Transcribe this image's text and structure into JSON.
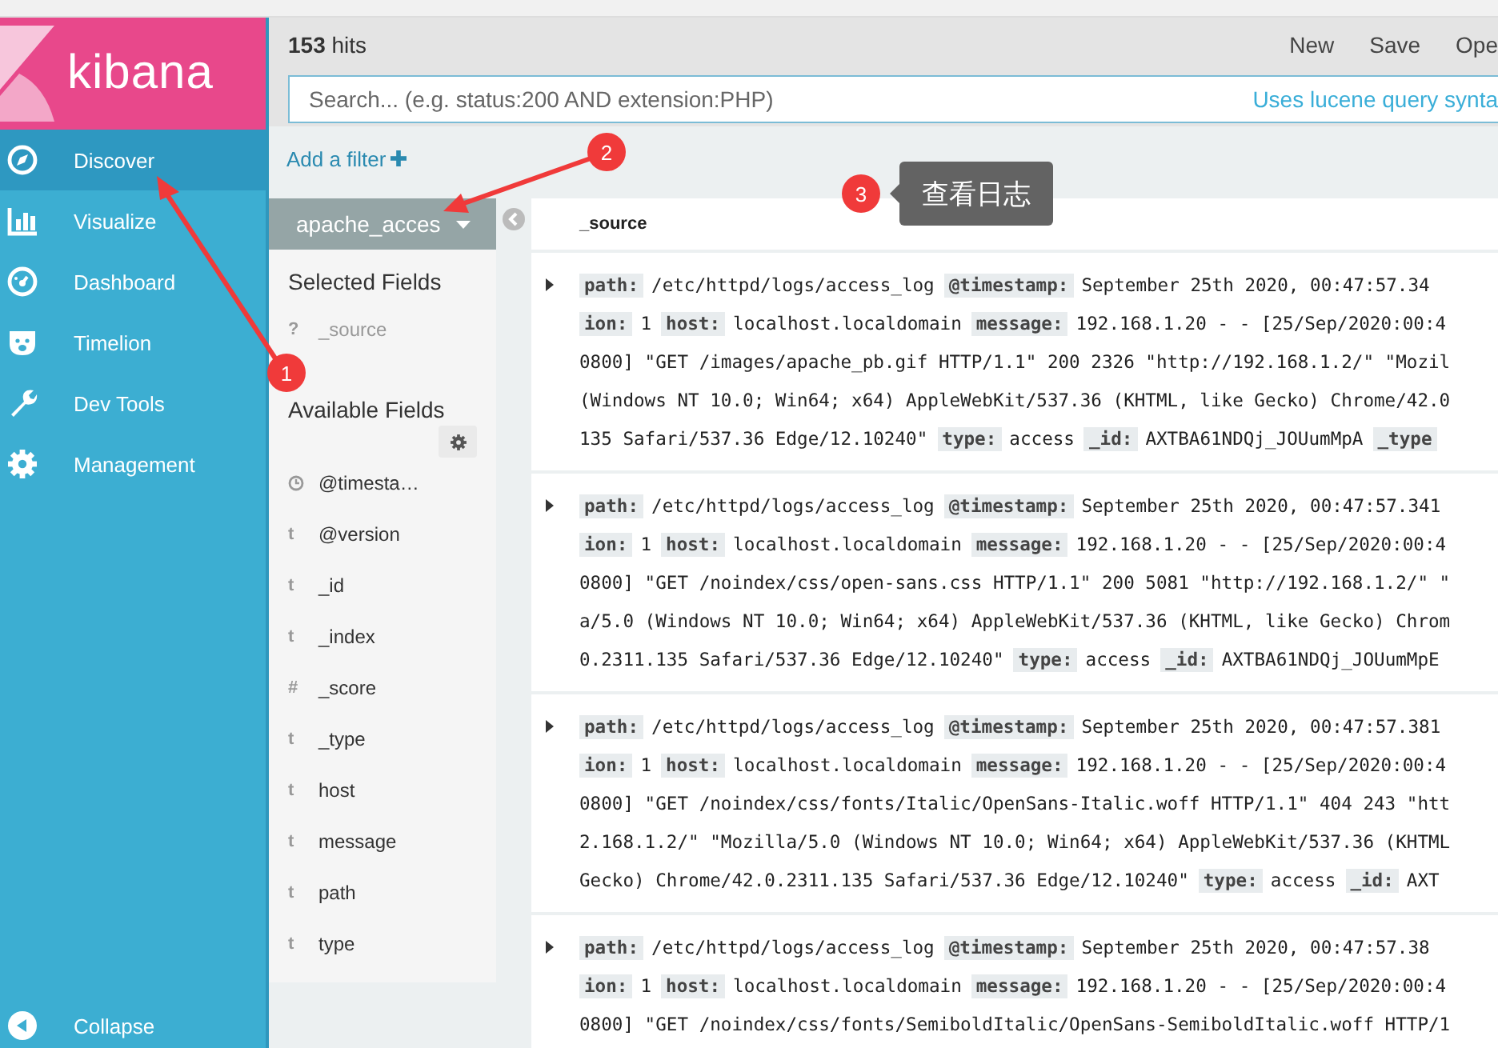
{
  "logo": {
    "text": "kibana"
  },
  "nav": {
    "items": [
      {
        "label": "Discover",
        "selected": true
      },
      {
        "label": "Visualize",
        "selected": false
      },
      {
        "label": "Dashboard",
        "selected": false
      },
      {
        "label": "Timelion",
        "selected": false
      },
      {
        "label": "Dev Tools",
        "selected": false
      },
      {
        "label": "Management",
        "selected": false
      }
    ],
    "collapse": "Collapse"
  },
  "header": {
    "hits": "**153** hits",
    "actions": [
      "New",
      "Save",
      "Ope"
    ]
  },
  "search": {
    "placeholder": "Search... (e.g. status:200 AND extension:PHP)",
    "syntax_link": "Uses lucene query synta"
  },
  "filter_bar": {
    "add_filter": "Add a filter"
  },
  "index_pattern": "apache_acces",
  "fields": {
    "selected_title": "Selected Fields",
    "selected": [
      {
        "kind": "glyph",
        "type": "?",
        "name": "_source"
      }
    ],
    "available_title": "Available Fields",
    "available": [
      {
        "kind": "date",
        "name": "@timesta…"
      },
      {
        "kind": "glyph",
        "type": "t",
        "name": "@version"
      },
      {
        "kind": "glyph",
        "type": "t",
        "name": "_id"
      },
      {
        "kind": "glyph",
        "type": "t",
        "name": "_index"
      },
      {
        "kind": "glyph",
        "type": "#",
        "name": "_score"
      },
      {
        "kind": "glyph",
        "type": "t",
        "name": "_type"
      },
      {
        "kind": "glyph",
        "type": "t",
        "name": "host"
      },
      {
        "kind": "glyph",
        "type": "t",
        "name": "message"
      },
      {
        "kind": "glyph",
        "type": "t",
        "name": "path"
      },
      {
        "kind": "glyph",
        "type": "t",
        "name": "type"
      }
    ]
  },
  "documents": {
    "column": "_source",
    "rows": [
      {
        "lines": [
          [
            {
              "kind": "key",
              "text": "path:"
            },
            {
              "kind": "text",
              "text": "/etc/httpd/logs/access_log"
            },
            {
              "kind": "key",
              "text": "@timestamp:"
            },
            {
              "kind": "text",
              "text": "September 25th 2020, 00:47:57.34"
            }
          ],
          [
            {
              "kind": "key",
              "text": "ion:"
            },
            {
              "kind": "text",
              "text": "1"
            },
            {
              "kind": "key",
              "text": "host:"
            },
            {
              "kind": "text",
              "text": "localhost.localdomain"
            },
            {
              "kind": "key",
              "text": "message:"
            },
            {
              "kind": "text",
              "text": "192.168.1.20 - - [25/Sep/2020:00:4"
            }
          ],
          [
            {
              "kind": "text",
              "text": "0800] \"GET /images/apache_pb.gif HTTP/1.1\" 200 2326 \"http://192.168.1.2/\" \"Mozil"
            }
          ],
          [
            {
              "kind": "text",
              "text": "(Windows NT 10.0; Win64; x64) AppleWebKit/537.36 (KHTML, like Gecko) Chrome/42.0"
            }
          ],
          [
            {
              "kind": "text",
              "text": "135 Safari/537.36 Edge/12.10240\""
            },
            {
              "kind": "key",
              "text": "type:"
            },
            {
              "kind": "text",
              "text": "access"
            },
            {
              "kind": "key",
              "text": "_id:"
            },
            {
              "kind": "text",
              "text": "AXTBA61NDQj_JOUumMpA"
            },
            {
              "kind": "key",
              "text": "_type"
            }
          ]
        ]
      },
      {
        "lines": [
          [
            {
              "kind": "key",
              "text": "path:"
            },
            {
              "kind": "text",
              "text": "/etc/httpd/logs/access_log"
            },
            {
              "kind": "key",
              "text": "@timestamp:"
            },
            {
              "kind": "text",
              "text": "September 25th 2020, 00:47:57.341"
            }
          ],
          [
            {
              "kind": "key",
              "text": "ion:"
            },
            {
              "kind": "text",
              "text": "1"
            },
            {
              "kind": "key",
              "text": "host:"
            },
            {
              "kind": "text",
              "text": "localhost.localdomain"
            },
            {
              "kind": "key",
              "text": "message:"
            },
            {
              "kind": "text",
              "text": "192.168.1.20 - - [25/Sep/2020:00:4"
            }
          ],
          [
            {
              "kind": "text",
              "text": "0800] \"GET /noindex/css/open-sans.css HTTP/1.1\" 200 5081 \"http://192.168.1.2/\" \""
            }
          ],
          [
            {
              "kind": "text",
              "text": "a/5.0 (Windows NT 10.0; Win64; x64) AppleWebKit/537.36 (KHTML, like Gecko) Chrom"
            }
          ],
          [
            {
              "kind": "text",
              "text": "0.2311.135 Safari/537.36 Edge/12.10240\""
            },
            {
              "kind": "key",
              "text": "type:"
            },
            {
              "kind": "text",
              "text": "access"
            },
            {
              "kind": "key",
              "text": "_id:"
            },
            {
              "kind": "text",
              "text": "AXTBA61NDQj_JOUumMpE"
            }
          ]
        ]
      },
      {
        "lines": [
          [
            {
              "kind": "key",
              "text": "path:"
            },
            {
              "kind": "text",
              "text": "/etc/httpd/logs/access_log"
            },
            {
              "kind": "key",
              "text": "@timestamp:"
            },
            {
              "kind": "text",
              "text": "September 25th 2020, 00:47:57.381"
            }
          ],
          [
            {
              "kind": "key",
              "text": "ion:"
            },
            {
              "kind": "text",
              "text": "1"
            },
            {
              "kind": "key",
              "text": "host:"
            },
            {
              "kind": "text",
              "text": "localhost.localdomain"
            },
            {
              "kind": "key",
              "text": "message:"
            },
            {
              "kind": "text",
              "text": "192.168.1.20 - - [25/Sep/2020:00:4"
            }
          ],
          [
            {
              "kind": "text",
              "text": "0800] \"GET /noindex/css/fonts/Italic/OpenSans-Italic.woff HTTP/1.1\" 404 243 \"htt"
            }
          ],
          [
            {
              "kind": "text",
              "text": "2.168.1.2/\" \"Mozilla/5.0 (Windows NT 10.0; Win64; x64) AppleWebKit/537.36 (KHTML"
            }
          ],
          [
            {
              "kind": "text",
              "text": "Gecko) Chrome/42.0.2311.135 Safari/537.36 Edge/12.10240\""
            },
            {
              "kind": "key",
              "text": "type:"
            },
            {
              "kind": "text",
              "text": "access"
            },
            {
              "kind": "key",
              "text": "_id:"
            },
            {
              "kind": "text",
              "text": "AXT"
            }
          ]
        ]
      },
      {
        "lines": [
          [
            {
              "kind": "key",
              "text": "path:"
            },
            {
              "kind": "text",
              "text": "/etc/httpd/logs/access_log"
            },
            {
              "kind": "key",
              "text": "@timestamp:"
            },
            {
              "kind": "text",
              "text": "September 25th 2020, 00:47:57.38"
            }
          ],
          [
            {
              "kind": "key",
              "text": "ion:"
            },
            {
              "kind": "text",
              "text": "1"
            },
            {
              "kind": "key",
              "text": "host:"
            },
            {
              "kind": "text",
              "text": "localhost.localdomain"
            },
            {
              "kind": "key",
              "text": "message:"
            },
            {
              "kind": "text",
              "text": "192.168.1.20 - - [25/Sep/2020:00:4"
            }
          ],
          [
            {
              "kind": "text",
              "text": "0800] \"GET /noindex/css/fonts/SemiboldItalic/OpenSans-SemiboldItalic.woff HTTP/1"
            }
          ]
        ]
      }
    ]
  },
  "annotations": {
    "markers": [
      {
        "number": "1"
      },
      {
        "number": "2"
      },
      {
        "number": "3"
      }
    ],
    "tooltip": "查看日志"
  }
}
